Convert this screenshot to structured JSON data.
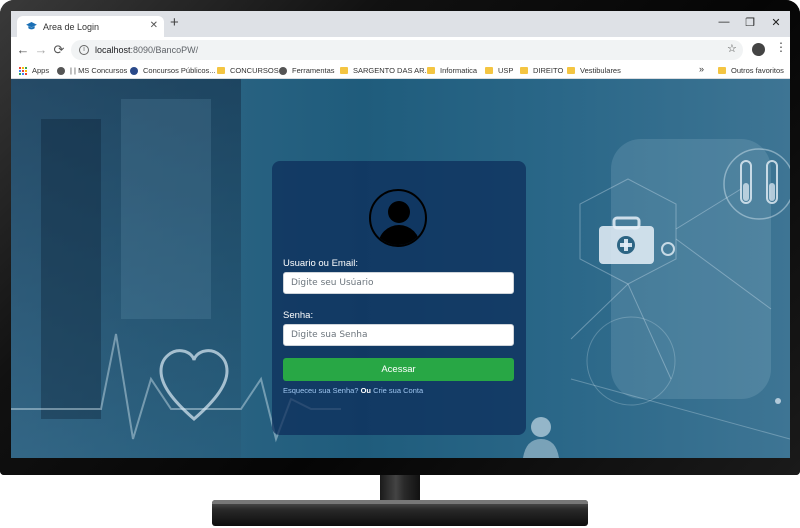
{
  "browser": {
    "tab_title": "Area de Login",
    "tab_close": "✕",
    "new_tab": "+",
    "window_controls": {
      "minimize": "—",
      "maximize": "❐",
      "close": "✕"
    },
    "nav": {
      "back": "←",
      "forward": "→",
      "reload": "⟳"
    },
    "url_host": "localhost",
    "url_path": ":8090/BancoPW/",
    "star": "☆",
    "menu": "⋮"
  },
  "bookmarks": {
    "items": [
      {
        "label": "Apps",
        "icon": "apps-grid-icon"
      },
      {
        "label": "| | MS Concursos",
        "icon": "globe-icon"
      },
      {
        "label": "Concursos Públicos...",
        "icon": "k-site-icon"
      },
      {
        "label": "CONCURSOS",
        "icon": "folder-icon"
      },
      {
        "label": "Ferramentas",
        "icon": "globe-icon"
      },
      {
        "label": "SARGENTO DAS AR...",
        "icon": "folder-icon"
      },
      {
        "label": "Informatica",
        "icon": "folder-icon"
      },
      {
        "label": "USP",
        "icon": "folder-icon"
      },
      {
        "label": "DIREITO",
        "icon": "folder-icon"
      },
      {
        "label": "Vestibulares",
        "icon": "folder-icon"
      }
    ],
    "overflow": "»",
    "other": "Outros favoritos"
  },
  "login": {
    "user_label": "Usuario ou Email:",
    "user_placeholder": "Digite seu Usúario",
    "password_label": "Senha:",
    "password_placeholder": "Digite sua Senha",
    "submit_label": "Acessar",
    "forgot_link": "Esqueceu sua Senha?",
    "or_text": "Ou",
    "create_link": "Crie sua Conta"
  },
  "colors": {
    "primary_button": "#28a745",
    "panel": "#0c2d5a",
    "link": "#9fc6f0"
  }
}
